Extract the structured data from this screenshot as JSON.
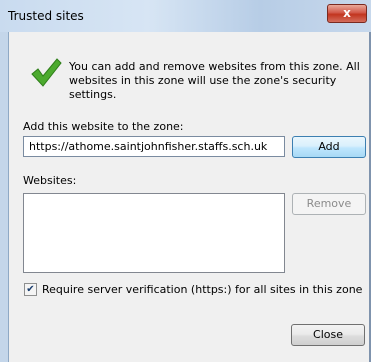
{
  "window": {
    "title": "Trusted sites",
    "close_glyph": "x"
  },
  "info": {
    "icon": "checkmark-icon",
    "text": "You can add and remove websites from this zone. All websites in this zone will use the zone's security settings."
  },
  "add_site": {
    "label": "Add this website to the zone:",
    "value": "https://athome.saintjohnfisher.staffs.sch.uk",
    "add_label": "Add"
  },
  "websites": {
    "label": "Websites:",
    "items": [],
    "remove_label": "Remove"
  },
  "verification": {
    "checked": true,
    "check_glyph": "✔",
    "label": "Require server verification (https:) for all sites in this zone"
  },
  "footer": {
    "close_label": "Close"
  },
  "colors": {
    "check_green": "#4caa2e",
    "close_red": "#c2351f"
  }
}
